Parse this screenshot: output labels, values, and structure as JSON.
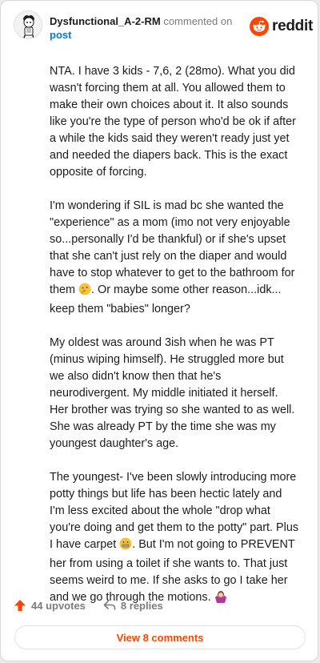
{
  "header": {
    "username": "Dysfunctional_A-2-RM",
    "action_text": "commented on",
    "post_link": "post",
    "brand": "reddit"
  },
  "comment": {
    "paragraphs": [
      {
        "text": "NTA. I have 3 kids - 7,6, 2 (28mo). What you did wasn't forcing them at all. You allowed them to make their own choices about it. It also sounds like you're the type of person who'd be ok if after a while the kids said they weren't ready just yet and needed the diapers back. This is the exact opposite of forcing."
      },
      {
        "text_before": "I'm wondering if SIL is mad bc she wanted the \"experience\" as a mom (imo not very enjoyable so...personally I'd be thankful) or if she's upset that she can't just rely on the diaper and would have to stop whatever to get to the bathroom for them ",
        "emoji": "thinking-face-emoji",
        "text_after": ". Or maybe some other reason...idk... keep them \"babies\" longer?"
      },
      {
        "text": "My oldest was around 3ish when he was PT (minus wiping himself). He struggled more but we also didn't know then that he's neurodivergent. My middle initiated it herself. Her brother was trying so she wanted to as well. She was already PT by the time she was my youngest daughter's age."
      },
      {
        "text_before": "The youngest- I've been slowly introducing more potty things but life has been hectic lately and I'm less excited about the whole \"drop what you're doing and get them to the potty\" part. Plus I have carpet ",
        "emoji": "grimacing-face-emoji",
        "text_mid": ". But I'm not going to PREVENT her from using a toilet if she wants to. That just seems weird to me. If she asks to go I take her and we go through the motions. ",
        "emoji2": "woman-shrugging-emoji"
      }
    ]
  },
  "footer": {
    "upvotes": "44 upvotes",
    "replies": "8 replies",
    "view_comments": "View 8 comments"
  },
  "colors": {
    "brand_orange": "#ff4500",
    "link_blue": "#0079d3",
    "meta_gray": "#7c7c7c"
  }
}
